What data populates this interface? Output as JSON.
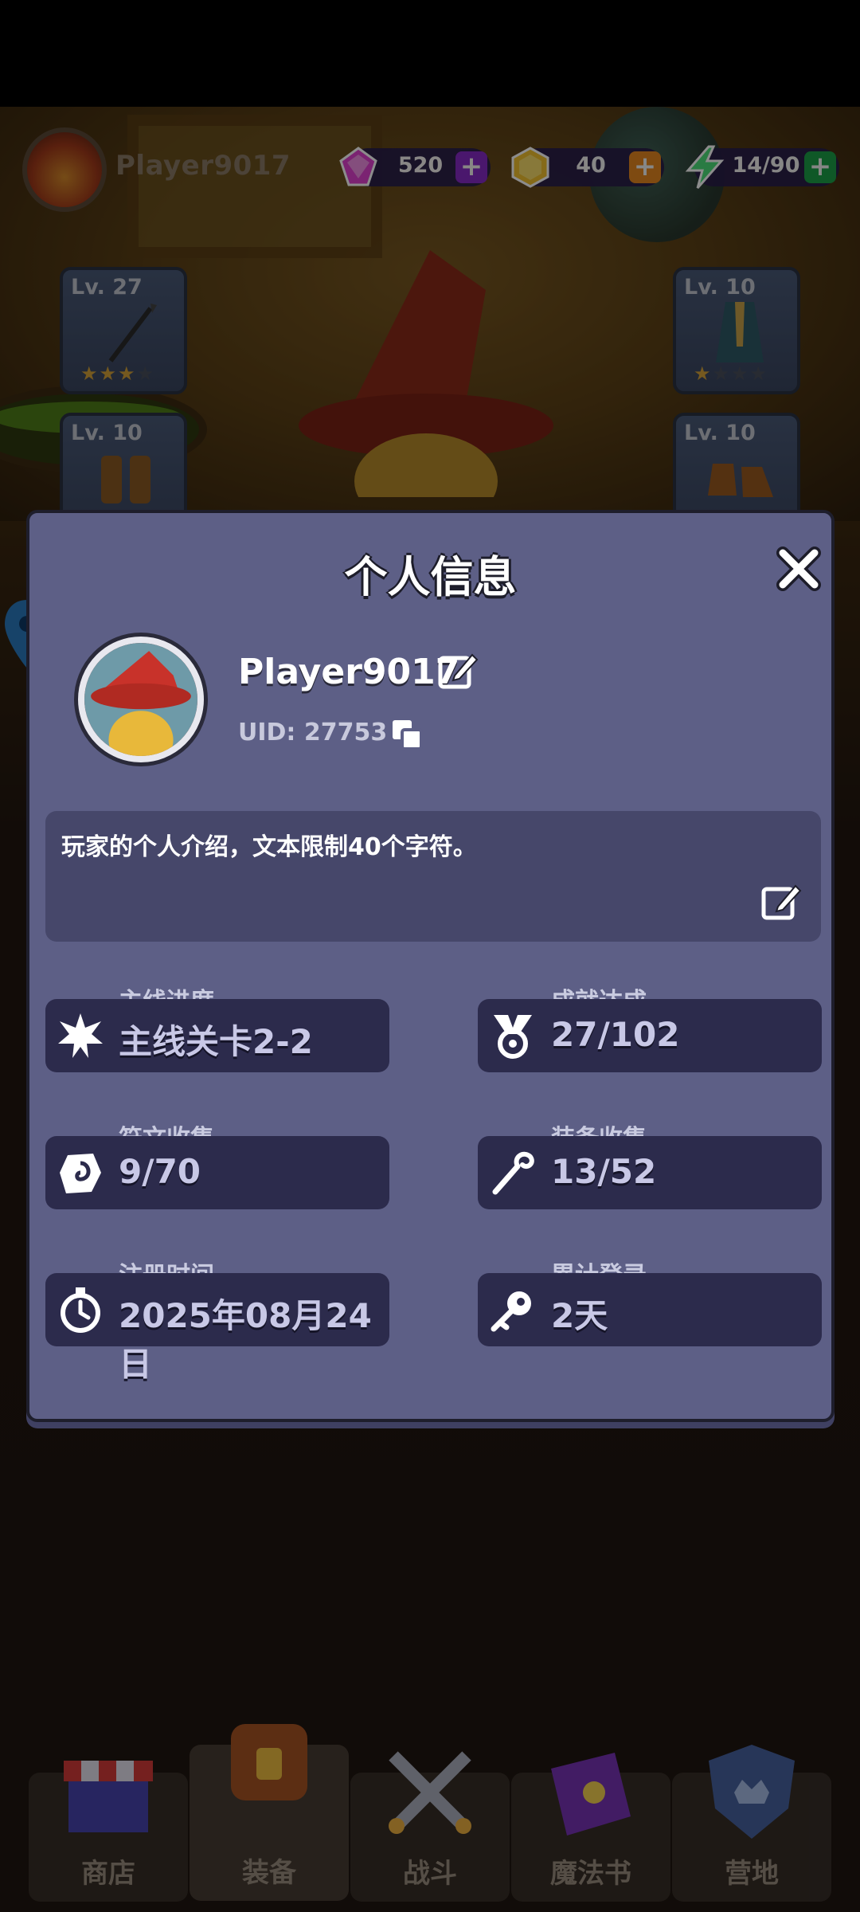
{
  "hud": {
    "player_name": "Player9017",
    "gems": "520",
    "gold": "40",
    "energy": "14/90",
    "gem_plus": "+",
    "gold_plus": "+",
    "energy_plus": "+"
  },
  "equipment_slots": [
    {
      "level": "Lv. 27",
      "stars": "★★★★",
      "filled_stars": 3
    },
    {
      "level": "Lv. 10",
      "stars": "★★★★",
      "filled_stars": 1
    },
    {
      "level": "Lv. 10"
    },
    {
      "level": "Lv. 10"
    }
  ],
  "modal": {
    "title": "个人信息",
    "player_name": "Player9017",
    "uid": "UID: 27753",
    "bio": "玩家的个人介绍，文本限制40个字符。",
    "stats": [
      {
        "label": "主线进度",
        "value": "主线关卡2-2",
        "icon": "burst-icon"
      },
      {
        "label": "成就达成",
        "value": "27/102",
        "icon": "medal-icon"
      },
      {
        "label": "符文收集",
        "value": "9/70",
        "icon": "rune-stone-icon"
      },
      {
        "label": "装备收集",
        "value": "13/52",
        "icon": "staff-icon"
      },
      {
        "label": "注册时间",
        "value": "2025年08月24日",
        "icon": "stopwatch-icon"
      },
      {
        "label": "累计登录",
        "value": "2天",
        "icon": "key-icon"
      }
    ]
  },
  "nav": [
    {
      "label": "商店",
      "icon": "shop-icon"
    },
    {
      "label": "装备",
      "icon": "backpack-icon",
      "active": true
    },
    {
      "label": "战斗",
      "icon": "crossed-swords-icon"
    },
    {
      "label": "魔法书",
      "icon": "spellbook-icon"
    },
    {
      "label": "营地",
      "icon": "camp-shield-icon"
    }
  ],
  "colors": {
    "modal_bg": "#5d5f86",
    "stat_box_bg": "#2c2b4c",
    "gem": "#e040d0",
    "gold": "#f2c12e",
    "energy": "#4ee07a"
  }
}
